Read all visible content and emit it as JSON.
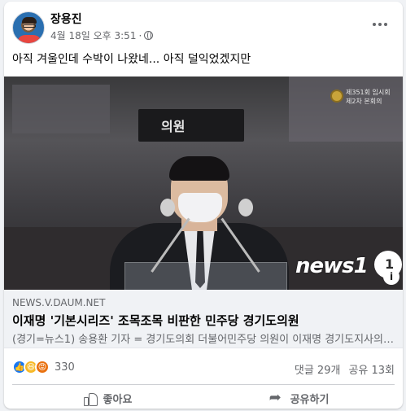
{
  "post": {
    "author": "장용진",
    "date": "4월 18일 오후 3:51",
    "separator": "·",
    "privacy_icon": "globe-icon",
    "text": "아직 겨울인데 수박이 나왔네... 아직 덜익었겠지만"
  },
  "media": {
    "nameplate_text": "의원",
    "session_line1": "제351회 임시회",
    "session_line2": "제2차 본회의",
    "watermark": "news1",
    "watermark_badge": "1",
    "info_badge": "i"
  },
  "link": {
    "domain": "NEWS.V.DAUM.NET",
    "title": "이재명 '기본시리즈' 조목조목 비판한 민주당 경기도의원",
    "description": "(경기=뉴스1) 송용환 기자 = 경기도의회 더불어민주당 의원이 이재명 경기도지사의 기본시리즈에 대해"
  },
  "stats": {
    "reaction_icons": [
      "like-icon",
      "haha-icon",
      "angry-icon"
    ],
    "reaction_count": "330",
    "comments": "댓글 29개",
    "shares": "공유 13회"
  },
  "actions": {
    "like_label": "좋아요",
    "share_label": "공유하기"
  },
  "colors": {
    "like_blue": "#1877f2",
    "haha_yellow": "#f7b928",
    "angry_orange": "#e9710f",
    "secondary_text": "#65676b"
  }
}
